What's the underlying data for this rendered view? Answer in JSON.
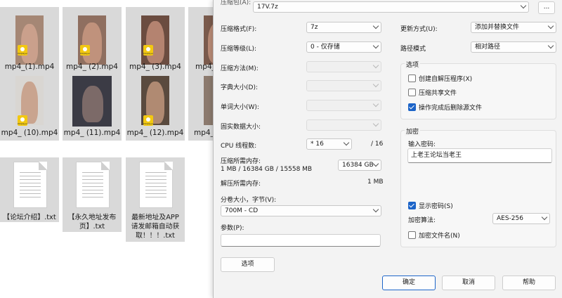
{
  "explorer": {
    "videos": [
      {
        "name": "mp4_(1).mp4"
      },
      {
        "name": "mp4_ (2).mp4"
      },
      {
        "name": "mp4_ (3).mp4"
      },
      {
        "name": "mp4_"
      },
      {
        "name": "mp4_ (10).mp4"
      },
      {
        "name": "mp4_ (11).mp4"
      },
      {
        "name": "mp4_ (12).mp4"
      },
      {
        "name": "mp4_"
      }
    ],
    "badge_text": "Potplayer",
    "texts": [
      {
        "line1": "【论坛介绍】.txt",
        "line2": "",
        "line3": ""
      },
      {
        "line1": "【永久地址发布",
        "line2": "页】.txt",
        "line3": ""
      },
      {
        "line1": "最新地址及APP",
        "line2": "请发邮箱自动获",
        "line3": "取！！！.txt"
      }
    ]
  },
  "dialog": {
    "archive_label": "压缩包(A):",
    "archive_value": "17V.7z",
    "browse_label": "...",
    "format_label": "压缩格式(F):",
    "format_value": "7z",
    "level_label": "压缩等级(L):",
    "level_value": "0 - 仅存储",
    "method_label": "压缩方法(M):",
    "dict_label": "字典大小(D):",
    "word_label": "单词大小(W):",
    "solid_label": "固实数据大小:",
    "threads_label": "CPU 线程数:",
    "threads_value": "* 16",
    "threads_total": "/ 16",
    "mem_comp_label": "压缩所需内存:",
    "mem_comp_detail": "1 MB / 16384 GB / 15558 MB",
    "mem_comp_value": "16384 GB",
    "mem_decomp_label": "解压所需内存:",
    "mem_decomp_value": "1 MB",
    "split_label": "分卷大小，字节(V):",
    "split_value": "700M - CD",
    "params_label": "参数(P):",
    "options_button": "选项",
    "update_label": "更新方式(U):",
    "update_value": "添加并替换文件",
    "path_label": "路径模式",
    "path_value": "相对路径",
    "options_group": "选项",
    "opt_sfx": "创建自解压程序(X)",
    "opt_shared": "压缩共享文件",
    "opt_delete": "操作完成后删除源文件",
    "encrypt_group": "加密",
    "password_label": "输入密码:",
    "password_value": "上老王论坛当老王",
    "show_password": "显示密码(S)",
    "enc_method_label": "加密算法:",
    "enc_method_value": "AES-256",
    "enc_names": "加密文件名(N)",
    "ok": "确定",
    "cancel": "取消",
    "help": "帮助"
  },
  "colors": {
    "accent": "#1c64c8",
    "selection": "#d9d9d9",
    "badge": "#f2c811"
  }
}
